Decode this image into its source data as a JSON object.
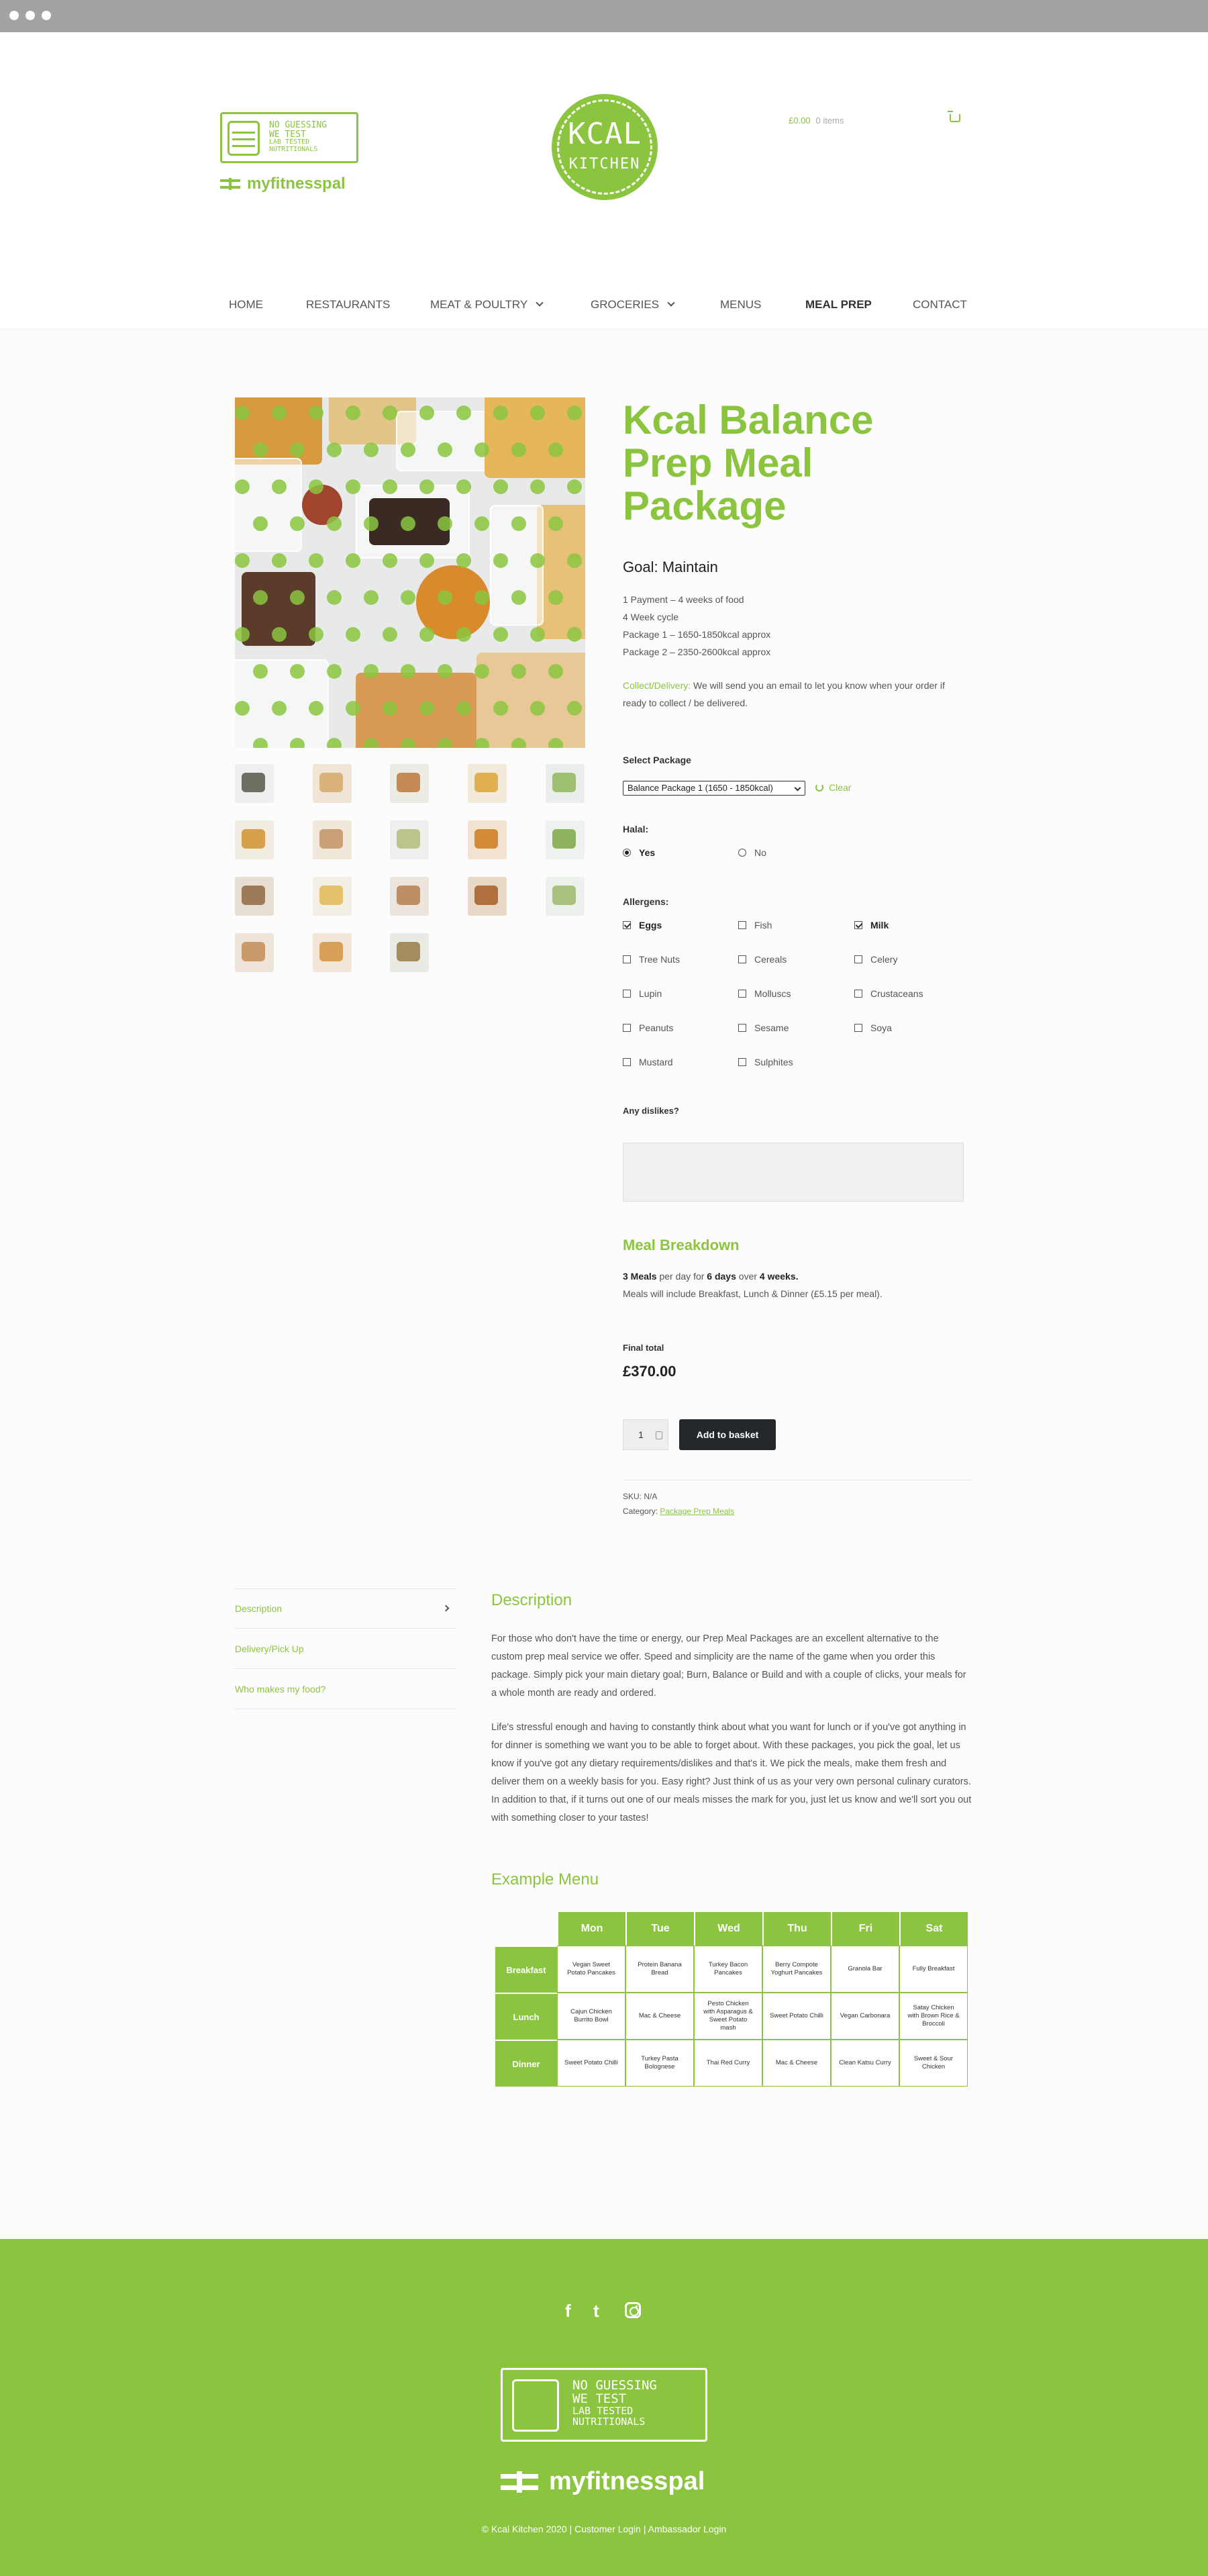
{
  "header": {
    "badge_lines": [
      "NO GUESSING",
      "WE TEST",
      "LAB TESTED NUTRITIONALS"
    ],
    "partner_logo": "myfitnesspal",
    "brand_line1": "KCAL",
    "brand_line2": "KITCHEN",
    "cart_total": "£0.00",
    "cart_items": "0 items",
    "cart_icon": "basket-icon"
  },
  "nav": [
    {
      "label": "HOME"
    },
    {
      "label": "RESTAURANTS"
    },
    {
      "label": "MEAT & POULTRY"
    },
    {
      "label": "GROCERIES"
    },
    {
      "label": "MENUS"
    },
    {
      "label": "MEAL PREP"
    },
    {
      "label": "CONTACT"
    }
  ],
  "product": {
    "title": "Kcal Balance Prep Meal Package",
    "goal": "Goal: Maintain",
    "details": [
      "1 Payment – 4 weeks of food",
      "4 Week cycle",
      "Package 1 – 1650-1850kcal approx",
      "Package 2 – 2350-2600kcal approx"
    ],
    "collect_label": "Collect/Delivery:",
    "collect_text": " We will send you an email to let you know when your order if ready to collect / be delivered.",
    "select_package_label": "Select Package",
    "select_package_value": "Balance Package 1 (1650 - 1850kcal)",
    "clear_label": "Clear",
    "halal_label": "Halal:",
    "halal_options": [
      {
        "label": "Yes",
        "selected": true
      },
      {
        "label": "No",
        "selected": false
      }
    ],
    "allergens_label": "Allergens:",
    "allergens": [
      {
        "label": "Eggs",
        "checked": true
      },
      {
        "label": "Fish",
        "checked": false
      },
      {
        "label": "Milk",
        "checked": true
      },
      {
        "label": "Tree Nuts",
        "checked": false
      },
      {
        "label": "Cereals",
        "checked": false
      },
      {
        "label": "Celery",
        "checked": false
      },
      {
        "label": "Lupin",
        "checked": false
      },
      {
        "label": "Molluscs",
        "checked": false
      },
      {
        "label": "Crustaceans",
        "checked": false
      },
      {
        "label": "Peanuts",
        "checked": false
      },
      {
        "label": "Sesame",
        "checked": false
      },
      {
        "label": "Soya",
        "checked": false
      },
      {
        "label": "Mustard",
        "checked": false
      },
      {
        "label": "Sulphites",
        "checked": false
      }
    ],
    "dislikes_label": "Any dislikes?",
    "dislikes_value": "",
    "meal_breakdown_title": "Meal Breakdown",
    "mb_meals": "3 Meals",
    "mb_per_day": " per day for ",
    "mb_days": "6 days",
    "mb_over": " over ",
    "mb_weeks": "4 weeks.",
    "mb_line2": "Meals will include Breakfast, Lunch & Dinner (£5.15 per meal).",
    "final_total_label": "Final total",
    "final_total_value": "£370.00",
    "quantity": "1",
    "add_to_basket": "Add to basket",
    "sku_label": "SKU:",
    "sku_value": "N/A",
    "category_label": "Category:",
    "category_value": "Package Prep Meals"
  },
  "tabs": [
    {
      "label": "Description",
      "active": true
    },
    {
      "label": "Delivery/Pick Up",
      "active": false
    },
    {
      "label": "Who makes my food?",
      "active": false
    }
  ],
  "description": {
    "title": "Description",
    "p1": "For those who don't have the time or energy, our Prep Meal Packages are an excellent alternative to the custom prep meal service we offer. Speed and simplicity are the name of the game when you order this package. Simply pick your main dietary goal; Burn, Balance or Build and with a couple of clicks, your meals for a whole month are ready and ordered.",
    "p2": "Life's stressful enough and having to constantly think about what you want for lunch or if you've got anything in for dinner is something we want you to be able to forget about. With these packages, you pick the goal, let us know if you've got any dietary requirements/dislikes and that's it. We pick the meals, make them fresh and deliver them on a weekly basis for you. Easy right? Just think of us as your very own personal culinary curators. In addition to that, if it turns out one of our meals misses the mark for you, just let us know and we'll sort you out with something closer to your tastes!"
  },
  "example_menu": {
    "title": "Example Menu",
    "days": [
      "Mon",
      "Tue",
      "Wed",
      "Thu",
      "Fri",
      "Sat"
    ],
    "rows": [
      {
        "meal": "Breakfast",
        "items": [
          "Vegan Sweet Potato Pancakes",
          "Protein Banana Bread",
          "Turkey Bacon Pancakes",
          "Berry Compote Yoghurt Pancakes",
          "Granola Bar",
          "Fully Breakfast"
        ]
      },
      {
        "meal": "Lunch",
        "items": [
          "Cajun Chicken Burrito Bowl",
          "Mac & Cheese",
          "Pesto Chicken with Asparagus & Sweet Potato mash",
          "Sweet Potato Chilli",
          "Vegan Carbonara",
          "Satay Chicken with Brown Rice & Broccoli"
        ]
      },
      {
        "meal": "Dinner",
        "items": [
          "Sweet Potato Chilli",
          "Turkey Pasta Bolognese",
          "Thai Red Curry",
          "Mac & Cheese",
          "Clean Katsu Curry",
          "Sweet & Sour Chicken"
        ]
      }
    ]
  },
  "footer": {
    "social_icons": [
      "facebook-icon",
      "twitter-icon",
      "instagram-icon"
    ],
    "facebook_glyph": "f",
    "twitter_glyph": "t",
    "badge_lines": [
      "NO GUESSING",
      "WE TEST",
      "LAB TESTED NUTRITIONALS"
    ],
    "partner_logo": "myfitnesspal",
    "copyright": "© Kcal Kitchen 2020 | Customer Login | Ambassador Login"
  },
  "colors": {
    "brand_green": "#8bc540",
    "button_dark": "#23282d"
  }
}
